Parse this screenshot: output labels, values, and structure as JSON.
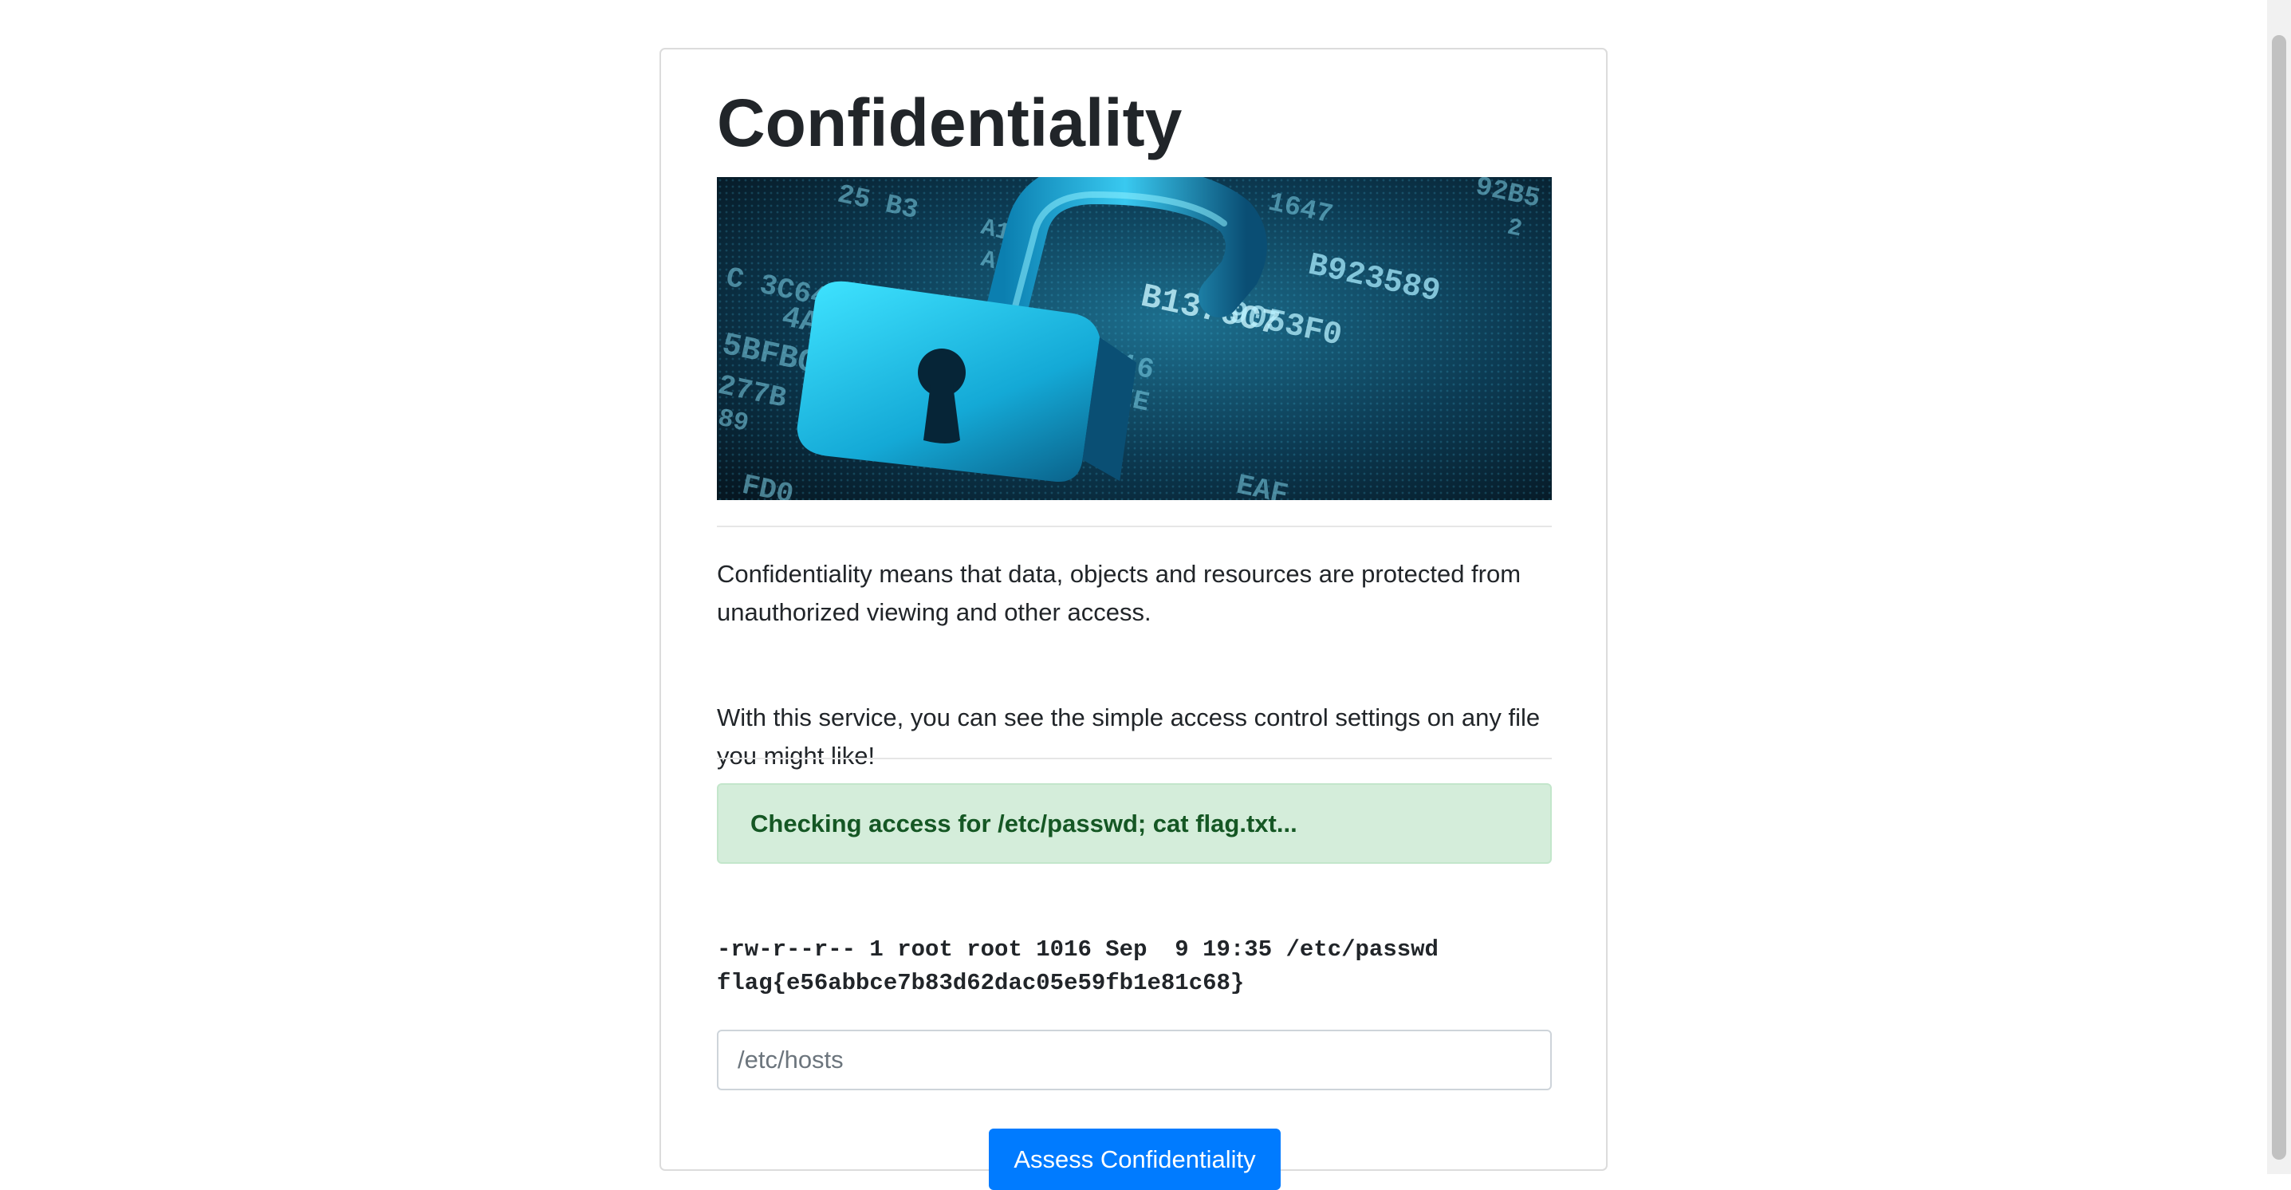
{
  "page": {
    "title": "Confidentiality",
    "hero_image": {
      "icon": "open-padlock-on-binary-code",
      "digits": [
        "25 B3",
        "A1 D",
        "ABD",
        "C 3C64064F",
        "4A468",
        "5BFBC56",
        "277B",
        "89",
        "1647",
        "2",
        "92B5",
        "B923589",
        "B1376C7",
        "9053F0",
        "08C16",
        "DEE",
        "FD0",
        "EAF"
      ]
    },
    "paragraphs": [
      "Confidentiality means that data, objects and resources are protected from unauthorized viewing and other access.",
      "With this service, you can see the simple access control settings on any file you might like!"
    ],
    "alert": {
      "text": "Checking access for /etc/passwd; cat flag.txt..."
    },
    "output_lines": {
      "line1": "-rw-r--r-- 1 root root 1016 Sep  9 19:35 /etc/passwd",
      "line2": "flag{e56abbce7b83d62dac05e59fb1e81c68}"
    },
    "file_input": {
      "value": "",
      "placeholder": "/etc/hosts"
    },
    "submit": {
      "label": "Assess Confidentiality"
    },
    "colors": {
      "primary": "#007bff",
      "alert_bg": "#d4edda",
      "alert_text": "#155724"
    }
  }
}
